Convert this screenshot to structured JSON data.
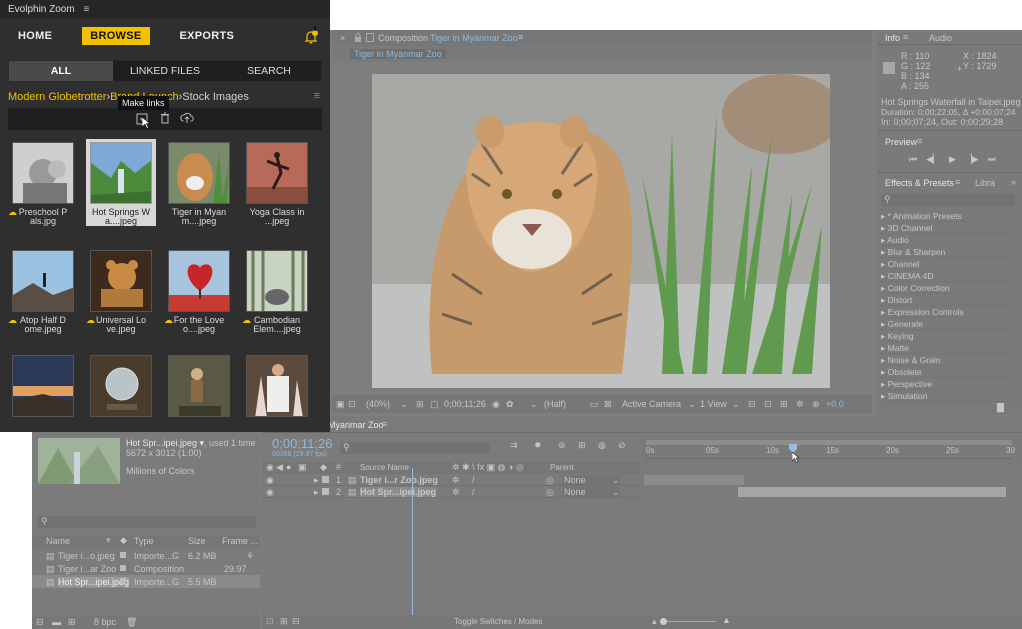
{
  "zoom": {
    "app_title": "Evolphin Zoom",
    "nav": {
      "home": "HOME",
      "browse": "BROWSE",
      "exports": "EXPORTS"
    },
    "notification_count": "8",
    "subtabs": {
      "all": "ALL",
      "linked": "LINKED FILES",
      "search": "SEARCH"
    },
    "breadcrumb": {
      "level1": "Modern Globetrotter",
      "sep1": " › ",
      "level2": "Brand Launch",
      "sep2": " › ",
      "level3": "Stock Images"
    },
    "tooltip": "Make links",
    "assets": [
      {
        "label": "Preschool P als.jpg"
      },
      {
        "label": "Hot Springs W a....jpeg"
      },
      {
        "label": "Tiger in Myan m....jpeg"
      },
      {
        "label": "Yoga Class in ...jpeg"
      },
      {
        "label": "Atop Half D ome.jpeg"
      },
      {
        "label": "Universal Lo ve.jpeg"
      },
      {
        "label": "For the Love o....jpeg"
      },
      {
        "label": "Cambodian Elem....jpeg"
      }
    ],
    "accent": "#f2c200"
  },
  "ae": {
    "comp_tab_prefix": "Composition",
    "comp_tab_name": "Tiger in Myanmar Zoo",
    "comp_subtab": "Tiger in Myanmar Zoo",
    "viewer_bar": {
      "zoom": "(40%)",
      "time": "0;00;11;26",
      "res": "(Half)",
      "camera": "Active Camera",
      "views": "1 View",
      "exposure": "+0.0"
    },
    "info": {
      "tab_info": "Info",
      "tab_audio": "Audio",
      "r": "R : 110",
      "g": "G : 122",
      "b": "B : 134",
      "a": "A : 255",
      "x": "X : 1824",
      "y": "Y : 1729",
      "file": "Hot Springs Waterfall in Taipei.jpeg",
      "duration": "Duration: 0;00;22;05, Δ +0;00;07;24",
      "inout": "In: 0;00;07;24, Out: 0;00;29;28"
    },
    "preview_title": "Preview",
    "effects": {
      "tab": "Effects & Presets",
      "tab2": "Libra",
      "items": [
        "* Animation Presets",
        "3D Channel",
        "Audio",
        "Blur & Sharpen",
        "Channel",
        "CINEMA 4D",
        "Color Correction",
        "Distort",
        "Expression Controls",
        "Generate",
        "Keying",
        "Matte",
        "Noise & Grain",
        "Obsolete",
        "Perspective",
        "Simulation"
      ]
    },
    "project": {
      "file_name": "Hot Spr...ipei.jpeg ▾",
      "used": ", used 1 time",
      "dims": "5672 x 3012 (1.00)",
      "colors": "Millions of Colors",
      "cols": {
        "name": "Name",
        "type": "Type",
        "size": "Size",
        "frame": "Frame ..."
      },
      "rows": [
        {
          "name": "Tiger i...o.jpeg",
          "type": "Importe...G",
          "size": "6.2 MB",
          "frame": ""
        },
        {
          "name": "Tiger i...ar Zoo",
          "type": "Composition",
          "size": "",
          "frame": "29.97"
        },
        {
          "name": "Hot Spr...ipei.jpeg",
          "type": "Importe...G",
          "size": "5.5 MB",
          "frame": ""
        }
      ],
      "bpc": "8 bpc"
    },
    "timeline": {
      "tab": "Myanmar Zoo",
      "timecode": "0;00;11;26",
      "timecode_sub": "00356 (29.97 fps)",
      "col_source": "Source Name",
      "col_parent": "Parent",
      "layers": [
        {
          "num": "1",
          "name": "Tiger i...r Zoo.jpeg",
          "parent": "None"
        },
        {
          "num": "2",
          "name": "Hot Spr...ipei.jpeg",
          "parent": "None"
        }
      ],
      "ruler": [
        "0s",
        "05s",
        "10s",
        "15s",
        "20s",
        "25s",
        "30"
      ],
      "toggle_label": "Toggle Switches / Modes"
    }
  }
}
